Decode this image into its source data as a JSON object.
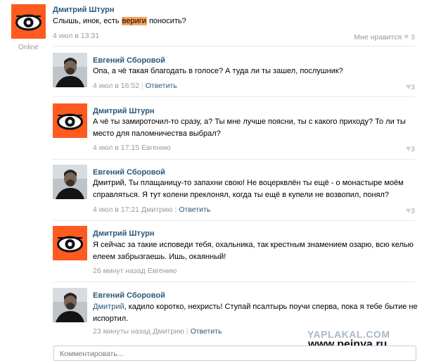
{
  "post": {
    "author": "Дмитрий Штурн",
    "text_before": "Слышь, инок, есть ",
    "text_highlight": "вериги",
    "text_after": " поносить?",
    "time": "4 июл в 13:31",
    "status": "Online",
    "like_label": "Мне нравится",
    "like_count": "3"
  },
  "comments": [
    {
      "author": "Евгений Сборовой",
      "lines": [
        "Опа, а чё такая благодать в голосе? А туда ли ты зашел, послушник?"
      ],
      "time": "4 июл в 16:52",
      "reply_label": "Ответить",
      "likes": "3",
      "avatar": "man-photo"
    },
    {
      "author": "Дмитрий Штурн",
      "lines": [
        "А чё ты замироточил-то сразу, а? Ты мне лучше поясни, ты с какого приходу? То ли ты",
        "место для паломничества выбрал?"
      ],
      "time": "4 июл в 17:15",
      "reply_to": "Евгению",
      "likes": "3",
      "avatar": "eye-logo"
    },
    {
      "author": "Евгений Сборовой",
      "lines": [
        "Дмитрий, Ты плащаницу-то запахни свою! Не воцерквлён ты ещё - о монастыре моём",
        "справляться. Я тут колени преклонял, когда ты ещё в купели не возвопил, понял?"
      ],
      "time": "4 июл в 17:21",
      "reply_to": "Дмитрию",
      "reply_label": "Ответить",
      "likes": "3",
      "avatar": "man-photo"
    },
    {
      "author": "Дмитрий Штурн",
      "lines": [
        "Я сейчас за такие исповеди тебя, охальника, так крестным знамением озарю, всю келью",
        "елеем забрызгаешь. Ишь, окаянный!"
      ],
      "time": "26 минут назад",
      "reply_to": "Евгению",
      "avatar": "eye-logo"
    },
    {
      "author": "Евгений Сборовой",
      "lines_prefix": "Дмитрий",
      "lines": [
        ", кадило коротко, нехристь! Ступай псалтырь поучи сперва, пока я тебе бытие не",
        "испортил."
      ],
      "time": "23 минуты назад",
      "reply_to": "Дмитрию",
      "reply_label": "Ответить",
      "avatar": "man-photo"
    }
  ],
  "comment_input": {
    "placeholder": "Комментировать..."
  },
  "watermarks": {
    "yaplakal": "YAPLAKAL.COM",
    "pejnya": "www.pejnya.ru"
  },
  "colors": {
    "link": "#2b587a",
    "meta": "#999999",
    "logo_orange": "#ff5a1f",
    "highlight": "#f7a35c"
  }
}
